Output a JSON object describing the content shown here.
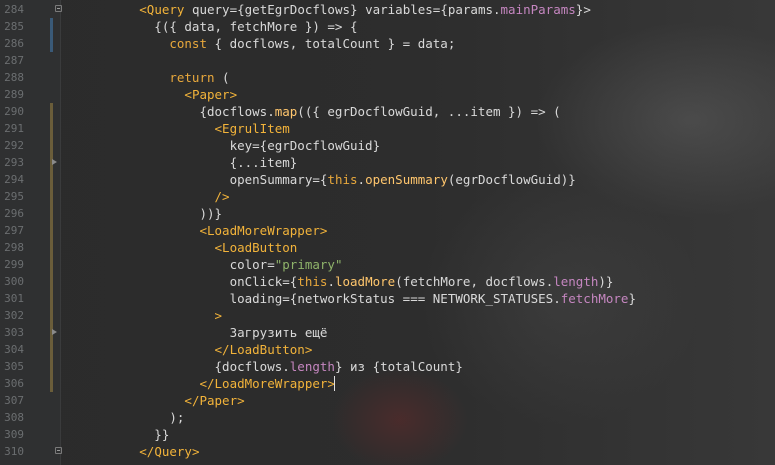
{
  "editor": {
    "lines": [
      {
        "number": "284",
        "mark": "",
        "fold": true,
        "arrow": false,
        "tokens": [
          {
            "t": "pl",
            "v": "          "
          },
          {
            "t": "tag",
            "v": "<Query"
          },
          {
            "t": "pl",
            "v": " "
          },
          {
            "t": "at",
            "v": "query"
          },
          {
            "t": "pl",
            "v": "={getEgrDocflows} "
          },
          {
            "t": "at",
            "v": "variables"
          },
          {
            "t": "pl",
            "v": "={params."
          },
          {
            "t": "pr",
            "v": "mainParams"
          },
          {
            "t": "pl",
            "v": "}>"
          }
        ]
      },
      {
        "number": "285",
        "mark": "added",
        "fold": false,
        "arrow": false,
        "tokens": [
          {
            "t": "pl",
            "v": "            {({ data, fetchMore }) => {"
          }
        ]
      },
      {
        "number": "286",
        "mark": "added",
        "fold": false,
        "arrow": false,
        "tokens": [
          {
            "t": "pl",
            "v": "              "
          },
          {
            "t": "kw",
            "v": "const"
          },
          {
            "t": "pl",
            "v": " { docflows, totalCount } = data;"
          }
        ]
      },
      {
        "number": "287",
        "mark": "",
        "fold": false,
        "arrow": false,
        "tokens": [
          {
            "t": "pl",
            "v": ""
          }
        ]
      },
      {
        "number": "288",
        "mark": "",
        "fold": false,
        "arrow": false,
        "tokens": [
          {
            "t": "pl",
            "v": "              "
          },
          {
            "t": "kw",
            "v": "return"
          },
          {
            "t": "pl",
            "v": " ("
          }
        ]
      },
      {
        "number": "289",
        "mark": "",
        "fold": false,
        "arrow": false,
        "tokens": [
          {
            "t": "pl",
            "v": "                "
          },
          {
            "t": "tag",
            "v": "<Paper>"
          }
        ]
      },
      {
        "number": "290",
        "mark": "changed",
        "fold": false,
        "arrow": false,
        "tokens": [
          {
            "t": "pl",
            "v": "                  {docflows."
          },
          {
            "t": "fn",
            "v": "map"
          },
          {
            "t": "pl",
            "v": "(({ egrDocflowGuid, ...item }) => ("
          }
        ]
      },
      {
        "number": "291",
        "mark": "changed",
        "fold": false,
        "arrow": false,
        "tokens": [
          {
            "t": "pl",
            "v": "                    "
          },
          {
            "t": "tag",
            "v": "<EgrulItem"
          }
        ]
      },
      {
        "number": "292",
        "mark": "changed",
        "fold": false,
        "arrow": false,
        "tokens": [
          {
            "t": "pl",
            "v": "                      "
          },
          {
            "t": "at",
            "v": "key"
          },
          {
            "t": "pl",
            "v": "={egrDocflowGuid}"
          }
        ]
      },
      {
        "number": "293",
        "mark": "changed",
        "fold": false,
        "arrow": true,
        "tokens": [
          {
            "t": "pl",
            "v": "                      {...item}"
          }
        ]
      },
      {
        "number": "294",
        "mark": "changed",
        "fold": false,
        "arrow": false,
        "tokens": [
          {
            "t": "pl",
            "v": "                      "
          },
          {
            "t": "at",
            "v": "openSummary"
          },
          {
            "t": "pl",
            "v": "={"
          },
          {
            "t": "kw",
            "v": "this"
          },
          {
            "t": "pl",
            "v": "."
          },
          {
            "t": "fn",
            "v": "openSummary"
          },
          {
            "t": "pl",
            "v": "(egrDocflowGuid)}"
          }
        ]
      },
      {
        "number": "295",
        "mark": "changed",
        "fold": false,
        "arrow": false,
        "tokens": [
          {
            "t": "pl",
            "v": "                    "
          },
          {
            "t": "tag",
            "v": "/>"
          }
        ]
      },
      {
        "number": "296",
        "mark": "changed",
        "fold": false,
        "arrow": false,
        "tokens": [
          {
            "t": "pl",
            "v": "                  ))}"
          }
        ]
      },
      {
        "number": "297",
        "mark": "changed",
        "fold": false,
        "arrow": false,
        "tokens": [
          {
            "t": "pl",
            "v": "                  "
          },
          {
            "t": "tag",
            "v": "<LoadMoreWrapper>"
          }
        ]
      },
      {
        "number": "298",
        "mark": "changed",
        "fold": false,
        "arrow": false,
        "tokens": [
          {
            "t": "pl",
            "v": "                    "
          },
          {
            "t": "tag",
            "v": "<LoadButton"
          }
        ]
      },
      {
        "number": "299",
        "mark": "changed",
        "fold": false,
        "arrow": false,
        "tokens": [
          {
            "t": "pl",
            "v": "                      "
          },
          {
            "t": "at",
            "v": "color"
          },
          {
            "t": "pl",
            "v": "="
          },
          {
            "t": "st",
            "v": "\"primary\""
          }
        ]
      },
      {
        "number": "300",
        "mark": "changed",
        "fold": false,
        "arrow": false,
        "tokens": [
          {
            "t": "pl",
            "v": "                      "
          },
          {
            "t": "at",
            "v": "onClick"
          },
          {
            "t": "pl",
            "v": "={"
          },
          {
            "t": "kw",
            "v": "this"
          },
          {
            "t": "pl",
            "v": "."
          },
          {
            "t": "fn",
            "v": "loadMore"
          },
          {
            "t": "pl",
            "v": "(fetchMore, docflows."
          },
          {
            "t": "pr",
            "v": "length"
          },
          {
            "t": "pl",
            "v": ")}"
          }
        ]
      },
      {
        "number": "301",
        "mark": "changed",
        "fold": false,
        "arrow": false,
        "tokens": [
          {
            "t": "pl",
            "v": "                      "
          },
          {
            "t": "at",
            "v": "loading"
          },
          {
            "t": "pl",
            "v": "={networkStatus === NETWORK_STATUSES."
          },
          {
            "t": "pr",
            "v": "fetchMore"
          },
          {
            "t": "pl",
            "v": "}"
          }
        ]
      },
      {
        "number": "302",
        "mark": "changed",
        "fold": false,
        "arrow": false,
        "tokens": [
          {
            "t": "pl",
            "v": "                    "
          },
          {
            "t": "tag",
            "v": ">"
          }
        ]
      },
      {
        "number": "303",
        "mark": "changed",
        "fold": false,
        "arrow": true,
        "tokens": [
          {
            "t": "pl",
            "v": "                      Загрузить ещё"
          }
        ]
      },
      {
        "number": "304",
        "mark": "changed",
        "fold": false,
        "arrow": false,
        "tokens": [
          {
            "t": "pl",
            "v": "                    "
          },
          {
            "t": "tag",
            "v": "</LoadButton>"
          }
        ]
      },
      {
        "number": "305",
        "mark": "changed",
        "fold": false,
        "arrow": false,
        "tokens": [
          {
            "t": "pl",
            "v": "                    {docflows."
          },
          {
            "t": "pr",
            "v": "length"
          },
          {
            "t": "pl",
            "v": "} из {totalCount}"
          }
        ]
      },
      {
        "number": "306",
        "mark": "changed",
        "fold": false,
        "arrow": false,
        "caret": true,
        "tokens": [
          {
            "t": "pl",
            "v": "                  "
          },
          {
            "t": "tag",
            "v": "</LoadMoreWrapper>"
          }
        ]
      },
      {
        "number": "307",
        "mark": "",
        "fold": false,
        "arrow": false,
        "tokens": [
          {
            "t": "pl",
            "v": "                "
          },
          {
            "t": "tag",
            "v": "</Paper>"
          }
        ]
      },
      {
        "number": "308",
        "mark": "",
        "fold": false,
        "arrow": false,
        "tokens": [
          {
            "t": "pl",
            "v": "              );"
          }
        ]
      },
      {
        "number": "309",
        "mark": "",
        "fold": false,
        "arrow": false,
        "tokens": [
          {
            "t": "pl",
            "v": "            }}"
          }
        ]
      },
      {
        "number": "310",
        "mark": "",
        "fold": true,
        "arrow": false,
        "tokens": [
          {
            "t": "pl",
            "v": "          "
          },
          {
            "t": "tag",
            "v": "</Query>"
          }
        ]
      }
    ]
  }
}
